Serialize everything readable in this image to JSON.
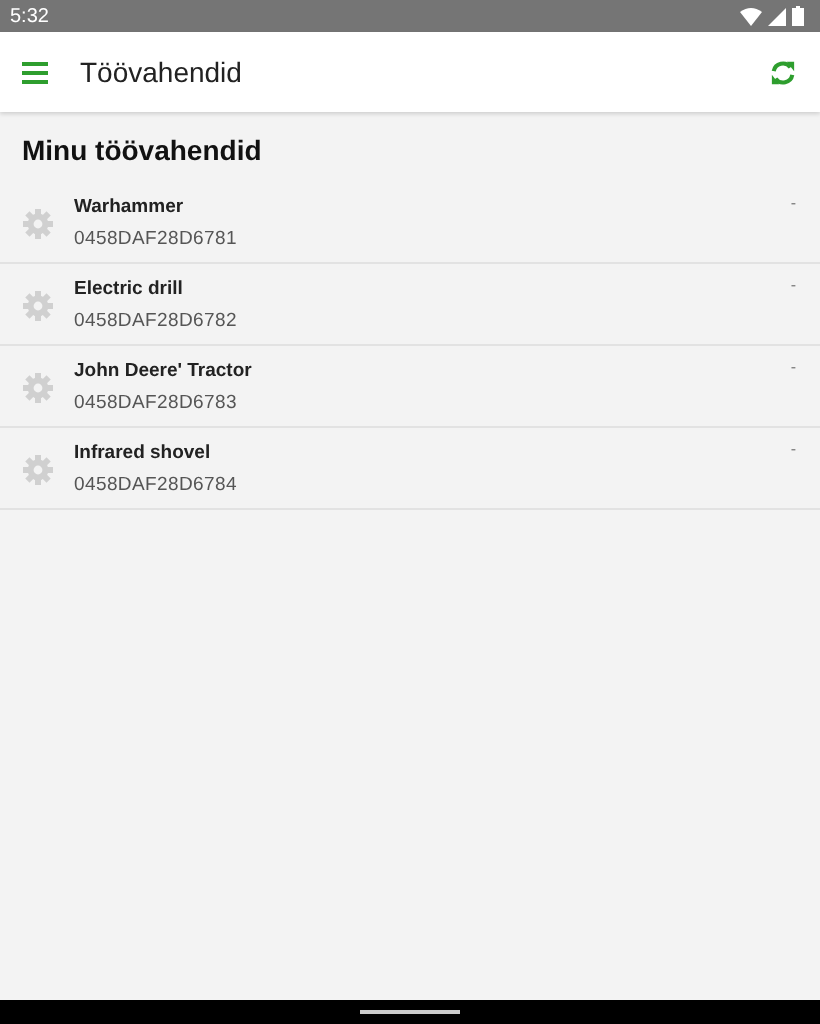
{
  "status_bar": {
    "time": "5:32"
  },
  "app_bar": {
    "title": "Töövahendid"
  },
  "section": {
    "title": "Minu töövahendid"
  },
  "tools": [
    {
      "name": "Warhammer",
      "code": "0458DAF28D6781",
      "status": "-"
    },
    {
      "name": "Electric drill",
      "code": "0458DAF28D6782",
      "status": "-"
    },
    {
      "name": "John Deere' Tractor",
      "code": "0458DAF28D6783",
      "status": "-"
    },
    {
      "name": "Infrared shovel",
      "code": "0458DAF28D6784",
      "status": "-"
    }
  ]
}
